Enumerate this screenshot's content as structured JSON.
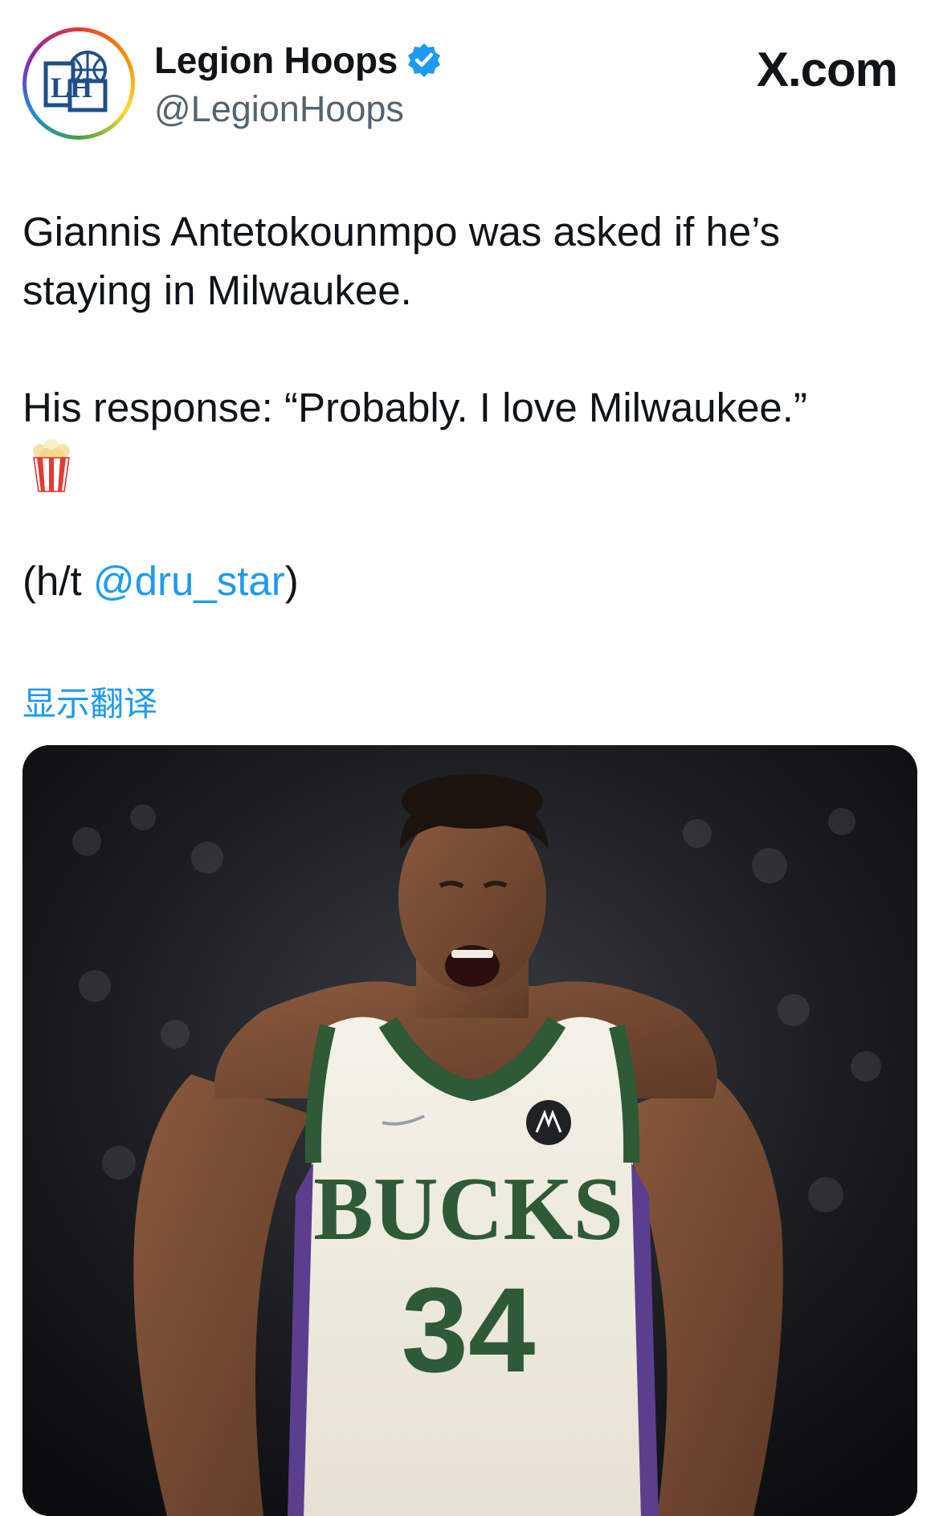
{
  "author": {
    "display_name": "Legion Hoops",
    "handle": "@LegionHoops",
    "verified": true,
    "avatar_text": "LH",
    "verified_icon": "verified-badge-icon"
  },
  "site_label": "X.com",
  "tweet": {
    "line1": "Giannis Antetokounmpo was asked if he’s staying in Milwaukee.",
    "line2": "His response: “Probably. I love Milwaukee.”",
    "emoji": "popcorn-icon",
    "credit_prefix": "(h/t ",
    "credit_mention": "@dru_star",
    "credit_suffix": ")"
  },
  "translate_label": "显示翻译",
  "media": {
    "jersey_team": "BUCKS",
    "jersey_number": "34"
  },
  "colors": {
    "link": "#1d9bf0",
    "text": "#0f1419",
    "secondary": "#536471",
    "bucks_green": "#2e5a36"
  }
}
